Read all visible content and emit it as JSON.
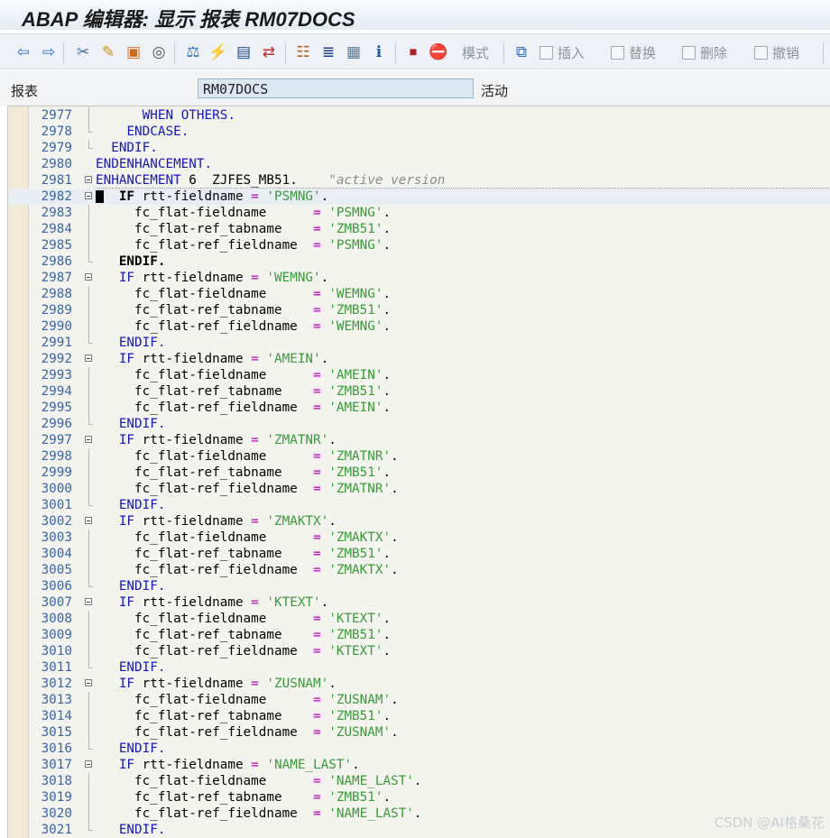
{
  "window": {
    "title": "ABAP 编辑器: 显示 报表 RM07DOCS"
  },
  "toolbar": {
    "icons": [
      {
        "name": "back-icon",
        "glyph": "⇦"
      },
      {
        "name": "forward-icon",
        "glyph": "⇨"
      },
      {
        "name": "other-object-icon",
        "glyph": "✂"
      },
      {
        "name": "display-change-icon",
        "glyph": "✎"
      },
      {
        "name": "active-inactive-icon",
        "glyph": "▣"
      },
      {
        "name": "other-object-icon-2",
        "glyph": "◎"
      },
      {
        "name": "check-icon",
        "glyph": "⚖"
      },
      {
        "name": "activate-icon",
        "glyph": "⚡"
      },
      {
        "name": "test-icon",
        "glyph": "▤"
      },
      {
        "name": "where-used-icon",
        "glyph": "⇄"
      },
      {
        "name": "object-list-icon",
        "glyph": "☷"
      },
      {
        "name": "navigation-window-icon",
        "glyph": "≣"
      },
      {
        "name": "layout-icon",
        "glyph": "▦"
      },
      {
        "name": "info-icon",
        "glyph": "ℹ"
      },
      {
        "name": "breakpoint-icon",
        "glyph": "⏹"
      },
      {
        "name": "stop-icon",
        "glyph": "⛔"
      }
    ],
    "pattern_label": "模式",
    "insert_label": "插入",
    "replace_label": "替换",
    "delete_label": "删除",
    "undo_label": "撤销"
  },
  "fields": {
    "report_label": "报表",
    "report_value": "RM07DOCS",
    "status": "活动"
  },
  "editor": {
    "lines": [
      {
        "n": "2977",
        "fold": "line",
        "tokens": [
          {
            "t": "      "
          },
          {
            "t": "WHEN OTHERS.",
            "c": "kw"
          }
        ]
      },
      {
        "n": "2978",
        "fold": "end",
        "tokens": [
          {
            "t": "    "
          },
          {
            "t": "ENDCASE.",
            "c": "kw"
          }
        ]
      },
      {
        "n": "2979",
        "fold": "end",
        "tokens": [
          {
            "t": "  "
          },
          {
            "t": "ENDIF.",
            "c": "kw"
          }
        ]
      },
      {
        "n": "2980",
        "fold": "none",
        "tokens": [
          {
            "t": "ENDENHANCEMENT.",
            "c": "kw"
          }
        ]
      },
      {
        "n": "2981",
        "fold": "box",
        "enh": true,
        "tokens": [
          {
            "t": "ENHANCEMENT",
            "c": "kw"
          },
          {
            "t": " 6  ZJFES_MB51.",
            "c": "id"
          },
          {
            "t": "    "
          },
          {
            "t": "\"active version",
            "c": "cmt"
          }
        ]
      },
      {
        "n": "2982",
        "fold": "box",
        "cur": true,
        "tokens": [
          {
            "t": "   "
          },
          {
            "t": "IF",
            "c": "kwb"
          },
          {
            "t": " rtt-fieldname ",
            "c": "id"
          },
          {
            "t": "=",
            "c": "op"
          },
          {
            "t": " "
          },
          {
            "t": "'PSMNG'",
            "c": "str"
          },
          {
            "t": ".",
            "c": "id"
          }
        ]
      },
      {
        "n": "2983",
        "fold": "line",
        "tokens": [
          {
            "t": "     fc_flat-fieldname      ",
            "c": "id"
          },
          {
            "t": "=",
            "c": "op"
          },
          {
            "t": " "
          },
          {
            "t": "'PSMNG'",
            "c": "str"
          },
          {
            "t": ".",
            "c": "id"
          }
        ]
      },
      {
        "n": "2984",
        "fold": "line",
        "tokens": [
          {
            "t": "     fc_flat-ref_tabname    ",
            "c": "id"
          },
          {
            "t": "=",
            "c": "op"
          },
          {
            "t": " "
          },
          {
            "t": "'ZMB51'",
            "c": "str"
          },
          {
            "t": ".",
            "c": "id"
          }
        ]
      },
      {
        "n": "2985",
        "fold": "line",
        "tokens": [
          {
            "t": "     fc_flat-ref_fieldname  ",
            "c": "id"
          },
          {
            "t": "=",
            "c": "op"
          },
          {
            "t": " "
          },
          {
            "t": "'PSMNG'",
            "c": "str"
          },
          {
            "t": ".",
            "c": "id"
          }
        ]
      },
      {
        "n": "2986",
        "fold": "end",
        "tokens": [
          {
            "t": "   "
          },
          {
            "t": "ENDIF.",
            "c": "kwb"
          }
        ]
      },
      {
        "n": "2987",
        "fold": "box",
        "tokens": [
          {
            "t": "   "
          },
          {
            "t": "IF",
            "c": "kw"
          },
          {
            "t": " rtt-fieldname ",
            "c": "id"
          },
          {
            "t": "=",
            "c": "op"
          },
          {
            "t": " "
          },
          {
            "t": "'WEMNG'",
            "c": "str"
          },
          {
            "t": ".",
            "c": "id"
          }
        ]
      },
      {
        "n": "2988",
        "fold": "line",
        "tokens": [
          {
            "t": "     fc_flat-fieldname      ",
            "c": "id"
          },
          {
            "t": "=",
            "c": "op"
          },
          {
            "t": " "
          },
          {
            "t": "'WEMNG'",
            "c": "str"
          },
          {
            "t": ".",
            "c": "id"
          }
        ]
      },
      {
        "n": "2989",
        "fold": "line",
        "tokens": [
          {
            "t": "     fc_flat-ref_tabname    ",
            "c": "id"
          },
          {
            "t": "=",
            "c": "op"
          },
          {
            "t": " "
          },
          {
            "t": "'ZMB51'",
            "c": "str"
          },
          {
            "t": ".",
            "c": "id"
          }
        ]
      },
      {
        "n": "2990",
        "fold": "line",
        "tokens": [
          {
            "t": "     fc_flat-ref_fieldname  ",
            "c": "id"
          },
          {
            "t": "=",
            "c": "op"
          },
          {
            "t": " "
          },
          {
            "t": "'WEMNG'",
            "c": "str"
          },
          {
            "t": ".",
            "c": "id"
          }
        ]
      },
      {
        "n": "2991",
        "fold": "end",
        "tokens": [
          {
            "t": "   "
          },
          {
            "t": "ENDIF.",
            "c": "kw"
          }
        ]
      },
      {
        "n": "2992",
        "fold": "box",
        "tokens": [
          {
            "t": "   "
          },
          {
            "t": "IF",
            "c": "kw"
          },
          {
            "t": " rtt-fieldname ",
            "c": "id"
          },
          {
            "t": "=",
            "c": "op"
          },
          {
            "t": " "
          },
          {
            "t": "'AMEIN'",
            "c": "str"
          },
          {
            "t": ".",
            "c": "id"
          }
        ]
      },
      {
        "n": "2993",
        "fold": "line",
        "tokens": [
          {
            "t": "     fc_flat-fieldname      ",
            "c": "id"
          },
          {
            "t": "=",
            "c": "op"
          },
          {
            "t": " "
          },
          {
            "t": "'AMEIN'",
            "c": "str"
          },
          {
            "t": ".",
            "c": "id"
          }
        ]
      },
      {
        "n": "2994",
        "fold": "line",
        "tokens": [
          {
            "t": "     fc_flat-ref_tabname    ",
            "c": "id"
          },
          {
            "t": "=",
            "c": "op"
          },
          {
            "t": " "
          },
          {
            "t": "'ZMB51'",
            "c": "str"
          },
          {
            "t": ".",
            "c": "id"
          }
        ]
      },
      {
        "n": "2995",
        "fold": "line",
        "tokens": [
          {
            "t": "     fc_flat-ref_fieldname  ",
            "c": "id"
          },
          {
            "t": "=",
            "c": "op"
          },
          {
            "t": " "
          },
          {
            "t": "'AMEIN'",
            "c": "str"
          },
          {
            "t": ".",
            "c": "id"
          }
        ]
      },
      {
        "n": "2996",
        "fold": "end",
        "tokens": [
          {
            "t": "   "
          },
          {
            "t": "ENDIF.",
            "c": "kw"
          }
        ]
      },
      {
        "n": "2997",
        "fold": "box",
        "tokens": [
          {
            "t": "   "
          },
          {
            "t": "IF",
            "c": "kw"
          },
          {
            "t": " rtt-fieldname ",
            "c": "id"
          },
          {
            "t": "=",
            "c": "op"
          },
          {
            "t": " "
          },
          {
            "t": "'ZMATNR'",
            "c": "str"
          },
          {
            "t": ".",
            "c": "id"
          }
        ]
      },
      {
        "n": "2998",
        "fold": "line",
        "tokens": [
          {
            "t": "     fc_flat-fieldname      ",
            "c": "id"
          },
          {
            "t": "=",
            "c": "op"
          },
          {
            "t": " "
          },
          {
            "t": "'ZMATNR'",
            "c": "str"
          },
          {
            "t": ".",
            "c": "id"
          }
        ]
      },
      {
        "n": "2999",
        "fold": "line",
        "tokens": [
          {
            "t": "     fc_flat-ref_tabname    ",
            "c": "id"
          },
          {
            "t": "=",
            "c": "op"
          },
          {
            "t": " "
          },
          {
            "t": "'ZMB51'",
            "c": "str"
          },
          {
            "t": ".",
            "c": "id"
          }
        ]
      },
      {
        "n": "3000",
        "fold": "line",
        "tokens": [
          {
            "t": "     fc_flat-ref_fieldname  ",
            "c": "id"
          },
          {
            "t": "=",
            "c": "op"
          },
          {
            "t": " "
          },
          {
            "t": "'ZMATNR'",
            "c": "str"
          },
          {
            "t": ".",
            "c": "id"
          }
        ]
      },
      {
        "n": "3001",
        "fold": "end",
        "tokens": [
          {
            "t": "   "
          },
          {
            "t": "ENDIF.",
            "c": "kw"
          }
        ]
      },
      {
        "n": "3002",
        "fold": "box",
        "tokens": [
          {
            "t": "   "
          },
          {
            "t": "IF",
            "c": "kw"
          },
          {
            "t": " rtt-fieldname ",
            "c": "id"
          },
          {
            "t": "=",
            "c": "op"
          },
          {
            "t": " "
          },
          {
            "t": "'ZMAKTX'",
            "c": "str"
          },
          {
            "t": ".",
            "c": "id"
          }
        ]
      },
      {
        "n": "3003",
        "fold": "line",
        "tokens": [
          {
            "t": "     fc_flat-fieldname      ",
            "c": "id"
          },
          {
            "t": "=",
            "c": "op"
          },
          {
            "t": " "
          },
          {
            "t": "'ZMAKTX'",
            "c": "str"
          },
          {
            "t": ".",
            "c": "id"
          }
        ]
      },
      {
        "n": "3004",
        "fold": "line",
        "tokens": [
          {
            "t": "     fc_flat-ref_tabname    ",
            "c": "id"
          },
          {
            "t": "=",
            "c": "op"
          },
          {
            "t": " "
          },
          {
            "t": "'ZMB51'",
            "c": "str"
          },
          {
            "t": ".",
            "c": "id"
          }
        ]
      },
      {
        "n": "3005",
        "fold": "line",
        "tokens": [
          {
            "t": "     fc_flat-ref_fieldname  ",
            "c": "id"
          },
          {
            "t": "=",
            "c": "op"
          },
          {
            "t": " "
          },
          {
            "t": "'ZMAKTX'",
            "c": "str"
          },
          {
            "t": ".",
            "c": "id"
          }
        ]
      },
      {
        "n": "3006",
        "fold": "end",
        "tokens": [
          {
            "t": "   "
          },
          {
            "t": "ENDIF.",
            "c": "kw"
          }
        ]
      },
      {
        "n": "3007",
        "fold": "box",
        "tokens": [
          {
            "t": "   "
          },
          {
            "t": "IF",
            "c": "kw"
          },
          {
            "t": " rtt-fieldname ",
            "c": "id"
          },
          {
            "t": "=",
            "c": "op"
          },
          {
            "t": " "
          },
          {
            "t": "'KTEXT'",
            "c": "str"
          },
          {
            "t": ".",
            "c": "id"
          }
        ]
      },
      {
        "n": "3008",
        "fold": "line",
        "tokens": [
          {
            "t": "     fc_flat-fieldname      ",
            "c": "id"
          },
          {
            "t": "=",
            "c": "op"
          },
          {
            "t": " "
          },
          {
            "t": "'KTEXT'",
            "c": "str"
          },
          {
            "t": ".",
            "c": "id"
          }
        ]
      },
      {
        "n": "3009",
        "fold": "line",
        "tokens": [
          {
            "t": "     fc_flat-ref_tabname    ",
            "c": "id"
          },
          {
            "t": "=",
            "c": "op"
          },
          {
            "t": " "
          },
          {
            "t": "'ZMB51'",
            "c": "str"
          },
          {
            "t": ".",
            "c": "id"
          }
        ]
      },
      {
        "n": "3010",
        "fold": "line",
        "tokens": [
          {
            "t": "     fc_flat-ref_fieldname  ",
            "c": "id"
          },
          {
            "t": "=",
            "c": "op"
          },
          {
            "t": " "
          },
          {
            "t": "'KTEXT'",
            "c": "str"
          },
          {
            "t": ".",
            "c": "id"
          }
        ]
      },
      {
        "n": "3011",
        "fold": "end",
        "tokens": [
          {
            "t": "   "
          },
          {
            "t": "ENDIF.",
            "c": "kw"
          }
        ]
      },
      {
        "n": "3012",
        "fold": "box",
        "tokens": [
          {
            "t": "   "
          },
          {
            "t": "IF",
            "c": "kw"
          },
          {
            "t": " rtt-fieldname ",
            "c": "id"
          },
          {
            "t": "=",
            "c": "op"
          },
          {
            "t": " "
          },
          {
            "t": "'ZUSNAM'",
            "c": "str"
          },
          {
            "t": ".",
            "c": "id"
          }
        ]
      },
      {
        "n": "3013",
        "fold": "line",
        "tokens": [
          {
            "t": "     fc_flat-fieldname      ",
            "c": "id"
          },
          {
            "t": "=",
            "c": "op"
          },
          {
            "t": " "
          },
          {
            "t": "'ZUSNAM'",
            "c": "str"
          },
          {
            "t": ".",
            "c": "id"
          }
        ]
      },
      {
        "n": "3014",
        "fold": "line",
        "tokens": [
          {
            "t": "     fc_flat-ref_tabname    ",
            "c": "id"
          },
          {
            "t": "=",
            "c": "op"
          },
          {
            "t": " "
          },
          {
            "t": "'ZMB51'",
            "c": "str"
          },
          {
            "t": ".",
            "c": "id"
          }
        ]
      },
      {
        "n": "3015",
        "fold": "line",
        "tokens": [
          {
            "t": "     fc_flat-ref_fieldname  ",
            "c": "id"
          },
          {
            "t": "=",
            "c": "op"
          },
          {
            "t": " "
          },
          {
            "t": "'ZUSNAM'",
            "c": "str"
          },
          {
            "t": ".",
            "c": "id"
          }
        ]
      },
      {
        "n": "3016",
        "fold": "end",
        "tokens": [
          {
            "t": "   "
          },
          {
            "t": "ENDIF.",
            "c": "kw"
          }
        ]
      },
      {
        "n": "3017",
        "fold": "box",
        "tokens": [
          {
            "t": "   "
          },
          {
            "t": "IF",
            "c": "kw"
          },
          {
            "t": " rtt-fieldname ",
            "c": "id"
          },
          {
            "t": "=",
            "c": "op"
          },
          {
            "t": " "
          },
          {
            "t": "'NAME_LAST'",
            "c": "str"
          },
          {
            "t": ".",
            "c": "id"
          }
        ]
      },
      {
        "n": "3018",
        "fold": "line",
        "tokens": [
          {
            "t": "     fc_flat-fieldname      ",
            "c": "id"
          },
          {
            "t": "=",
            "c": "op"
          },
          {
            "t": " "
          },
          {
            "t": "'NAME_LAST'",
            "c": "str"
          },
          {
            "t": ".",
            "c": "id"
          }
        ]
      },
      {
        "n": "3019",
        "fold": "line",
        "tokens": [
          {
            "t": "     fc_flat-ref_tabname    ",
            "c": "id"
          },
          {
            "t": "=",
            "c": "op"
          },
          {
            "t": " "
          },
          {
            "t": "'ZMB51'",
            "c": "str"
          },
          {
            "t": ".",
            "c": "id"
          }
        ]
      },
      {
        "n": "3020",
        "fold": "line",
        "tokens": [
          {
            "t": "     fc_flat-ref_fieldname  ",
            "c": "id"
          },
          {
            "t": "=",
            "c": "op"
          },
          {
            "t": " "
          },
          {
            "t": "'NAME_LAST'",
            "c": "str"
          },
          {
            "t": ".",
            "c": "id"
          }
        ]
      },
      {
        "n": "3021",
        "fold": "end",
        "tokens": [
          {
            "t": "   "
          },
          {
            "t": "ENDIF.",
            "c": "kw"
          }
        ]
      }
    ]
  },
  "watermark": "CSDN @AI格桑花",
  "colors": {
    "keyword": "#1515c8",
    "string": "#3a9a3a",
    "operator": "#c000c0",
    "line_number": "#3a64a8",
    "comment": "#8a8a8a"
  }
}
